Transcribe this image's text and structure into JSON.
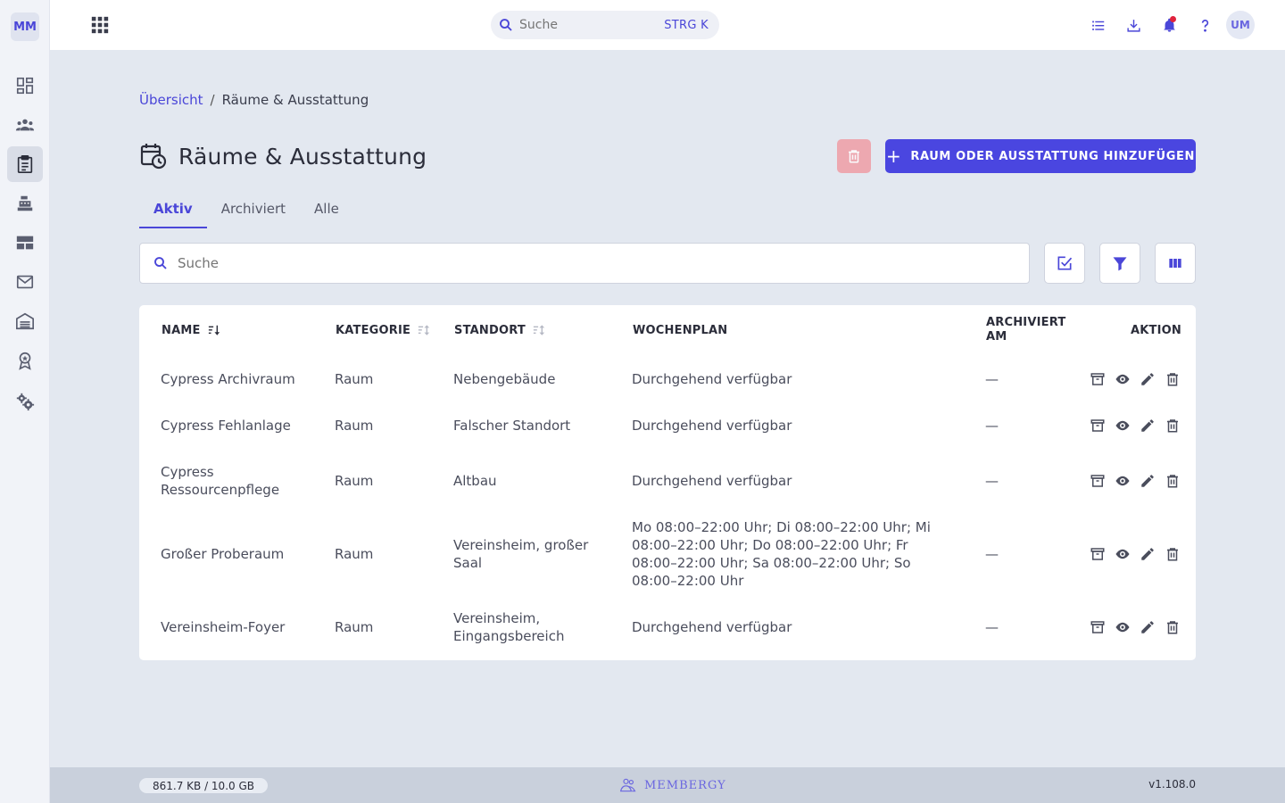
{
  "app": {
    "logo_text": "MM"
  },
  "sidebar": {
    "items": [
      {
        "name": "dashboard",
        "icon": "dashboard-icon",
        "active": false
      },
      {
        "name": "members",
        "icon": "people-icon",
        "active": false
      },
      {
        "name": "resources",
        "icon": "clipboard-icon",
        "active": true
      },
      {
        "name": "cash-register",
        "icon": "register-icon",
        "active": false
      },
      {
        "name": "layout",
        "icon": "table-layout-icon",
        "active": false
      },
      {
        "name": "mail",
        "icon": "mail-icon",
        "active": false
      },
      {
        "name": "warehouse",
        "icon": "warehouse-icon",
        "active": false
      },
      {
        "name": "awards",
        "icon": "award-icon",
        "active": false
      },
      {
        "name": "settings",
        "icon": "gears-icon",
        "active": false
      }
    ]
  },
  "topbar": {
    "search_placeholder": "Suche",
    "search_shortcut": "STRG K",
    "avatar_initials": "UM"
  },
  "breadcrumb": {
    "home": "Übersicht",
    "separator": "/",
    "current": "Räume & Ausstattung"
  },
  "page": {
    "title": "Räume & Ausstattung",
    "add_button": "RAUM ODER AUSSTATTUNG HINZUFÜGEN"
  },
  "tabs": [
    {
      "label": "Aktiv",
      "active": true
    },
    {
      "label": "Archiviert",
      "active": false
    },
    {
      "label": "Alle",
      "active": false
    }
  ],
  "search": {
    "placeholder": "Suche"
  },
  "table": {
    "headers": {
      "name": "NAME",
      "kategorie": "KATEGORIE",
      "standort": "STANDORT",
      "wochenplan": "WOCHENPLAN",
      "archiviert_1": "ARCHIVIERT",
      "archiviert_2": "AM",
      "aktion": "AKTION"
    },
    "rows": [
      {
        "name": "Cypress Archivraum",
        "kategorie": "Raum",
        "standort": "Nebengebäude",
        "wochenplan": "Durchgehend verfügbar",
        "archiviert": "—"
      },
      {
        "name": "Cypress Fehlanlage",
        "kategorie": "Raum",
        "standort": "Falscher Standort",
        "wochenplan": "Durchgehend verfügbar",
        "archiviert": "—"
      },
      {
        "name": "Cypress Ressourcenpflege",
        "kategorie": "Raum",
        "standort": "Altbau",
        "wochenplan": "Durchgehend verfügbar",
        "archiviert": "—"
      },
      {
        "name": "Großer Proberaum",
        "kategorie": "Raum",
        "standort": "Vereinsheim, großer Saal",
        "wochenplan": "Mo 08:00–22:00 Uhr; Di 08:00–22:00 Uhr; Mi 08:00–22:00 Uhr; Do 08:00–22:00 Uhr; Fr 08:00–22:00 Uhr; Sa 08:00–22:00 Uhr; So 08:00–22:00 Uhr",
        "archiviert": "—"
      },
      {
        "name": "Vereinsheim-Foyer",
        "kategorie": "Raum",
        "standort": "Vereinsheim, Eingangsbereich",
        "wochenplan": "Durchgehend verfügbar",
        "archiviert": "—"
      }
    ]
  },
  "footer": {
    "storage": "861.7 KB / 10.0 GB",
    "storage_fraction": 0.0001,
    "brand": "MEMBERGY",
    "version": "v1.108.0"
  },
  "colors": {
    "accent": "#4a46d8",
    "danger_disabled": "#ef9da6",
    "notification": "#e0233d"
  }
}
